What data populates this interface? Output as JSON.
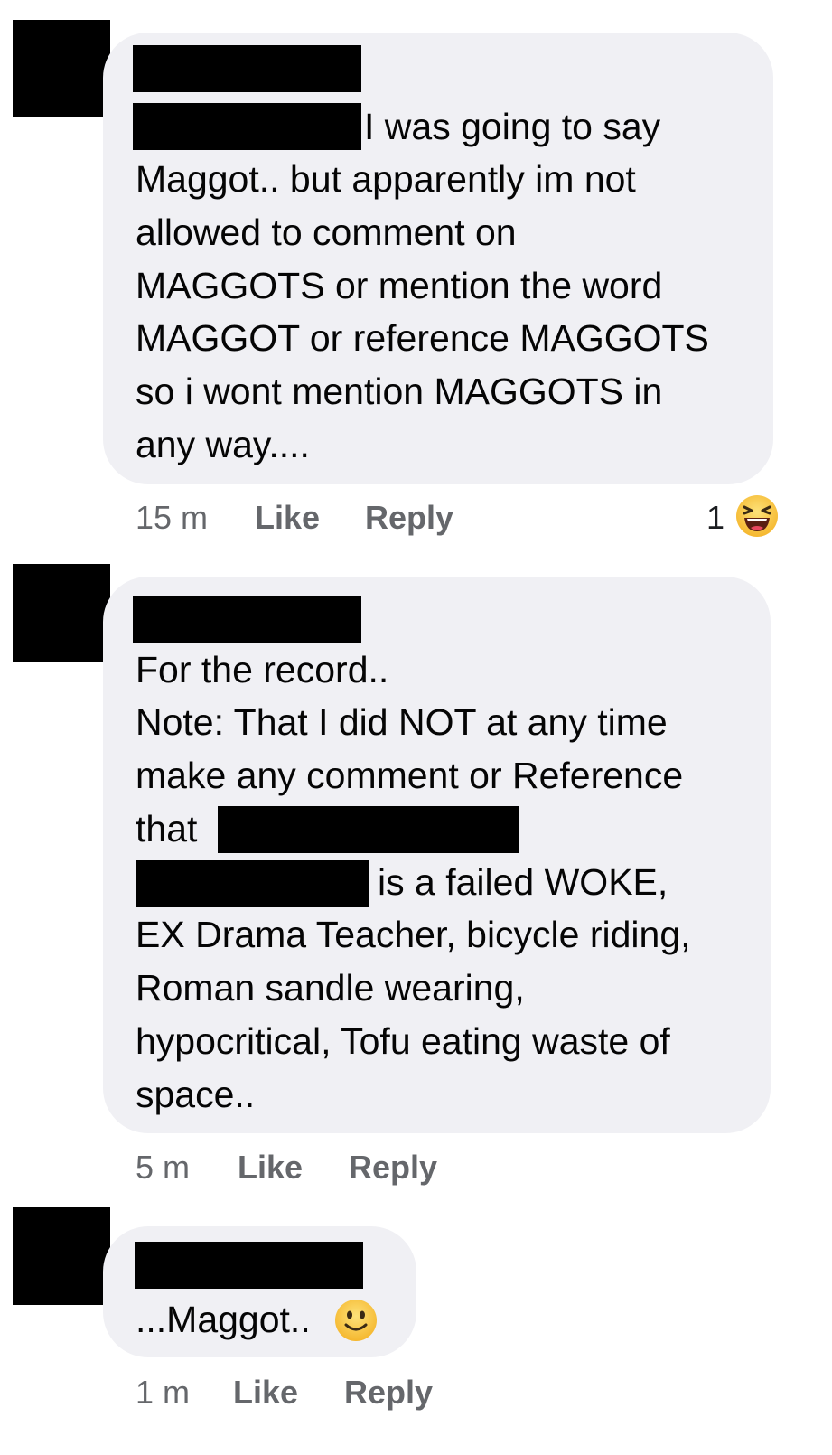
{
  "comments": [
    {
      "lines": [
        "I was going to say",
        "Maggot.. but apparently im not",
        "allowed to comment on",
        "MAGGOTS or mention the word",
        "MAGGOT or reference MAGGOTS",
        "so i wont mention MAGGOTS in",
        "any way...."
      ],
      "time": "15 m",
      "like": "Like",
      "reply": "Reply",
      "reaction_count": "1",
      "reaction_icon": "laughing-emoji-icon"
    },
    {
      "lines": [
        "For the record..",
        "Note: That I did NOT at any time",
        "make any comment or Reference",
        "that",
        "is a failed  WOKE,",
        "EX Drama Teacher, bicycle riding,",
        "Roman sandle  wearing,",
        "hypocritical, Tofu eating waste of",
        "space.."
      ],
      "time": "5 m",
      "like": "Like",
      "reply": "Reply"
    },
    {
      "lines": [
        "...Maggot.."
      ],
      "inline_icon": "slightly-smiling-face-icon",
      "time": "1 m",
      "like": "Like",
      "reply": "Reply"
    }
  ],
  "colors": {
    "bubble": "#f0f0f4",
    "meta_text": "#65676b",
    "redaction": "#000000",
    "emoji_yellow": "#f7c548"
  }
}
